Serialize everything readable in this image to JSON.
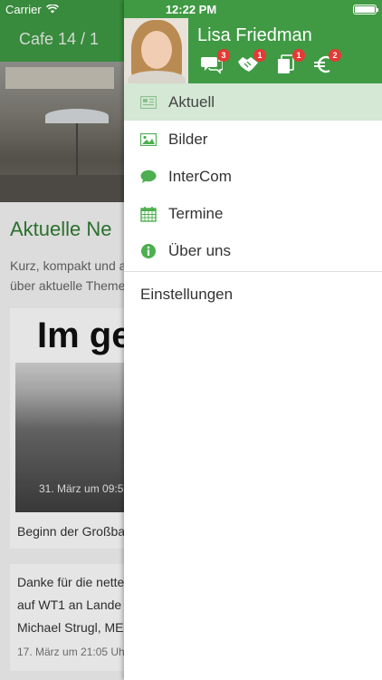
{
  "status_bar": {
    "carrier": "Carrier",
    "time": "12:22 PM"
  },
  "background_page": {
    "title": "Cafe 14 / 1",
    "section_heading": "Aktuelle Ne",
    "intro_line1": "Kurz, kompakt und a",
    "intro_line2": "über aktuelle Theme",
    "card1": {
      "headline": "Im ge",
      "date": "31. März um 09:5",
      "caption": "Beginn der Großba"
    },
    "card2": {
      "line1": "Danke für die nette",
      "line2": "auf WT1 an Lande",
      "line3": "Michael Strugl, ME",
      "date": "17. März um 21:05 Uh"
    }
  },
  "drawer": {
    "user_name": "Lisa Friedman",
    "header_icons": [
      {
        "icon": "chat-bubbles-icon",
        "badge": "3"
      },
      {
        "icon": "handshake-icon",
        "badge": "1"
      },
      {
        "icon": "documents-icon",
        "badge": "1"
      },
      {
        "icon": "euro-icon",
        "badge": "2"
      }
    ],
    "menu": [
      {
        "label": "Aktuell",
        "icon": "newspaper-icon",
        "active": true
      },
      {
        "label": "Bilder",
        "icon": "image-icon",
        "active": false
      },
      {
        "label": "InterCom",
        "icon": "speech-bubble-icon",
        "active": false
      },
      {
        "label": "Termine",
        "icon": "calendar-icon",
        "active": false
      },
      {
        "label": "Über uns",
        "icon": "info-icon",
        "active": false
      }
    ],
    "settings_label": "Einstellungen"
  },
  "colors": {
    "brand_green": "#3f9a43",
    "active_bg": "#d4e8d5",
    "badge_red": "#e53935",
    "icon_green": "#4caf50"
  }
}
